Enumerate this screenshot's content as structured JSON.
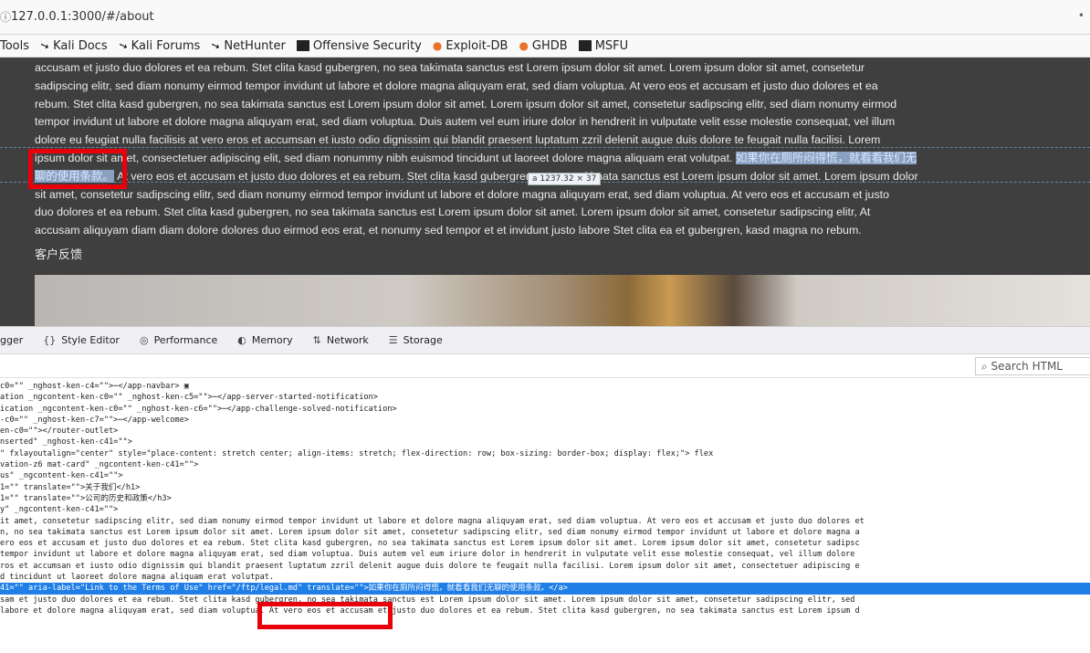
{
  "browser": {
    "url": "127.0.0.1:3000/#/about",
    "bookmarks": [
      "Tools",
      "Kali Docs",
      "Kali Forums",
      "NetHunter",
      "Offensive Security",
      "Exploit-DB",
      "GHDB",
      "MSFU"
    ]
  },
  "page": {
    "paragraph_lines": [
      "accusam et justo duo dolores et ea rebum. Stet clita kasd gubergren, no sea takimata sanctus est Lorem ipsum dolor sit amet. Lorem ipsum dolor sit amet, consetetur",
      "sadipscing elitr, sed diam nonumy eirmod tempor invidunt ut labore et dolore magna aliquyam erat, sed diam voluptua. At vero eos et accusam et justo duo dolores et ea",
      "rebum. Stet clita kasd gubergren, no sea takimata sanctus est Lorem ipsum dolor sit amet. Lorem ipsum dolor sit amet, consetetur sadipscing elitr, sed diam nonumy eirmod",
      "tempor invidunt ut labore et dolore magna aliquyam erat, sed diam voluptua. Duis autem vel eum iriure dolor in hendrerit in vulputate velit esse molestie consequat, vel illum",
      "dolore eu feugiat nulla facilisis at vero eros et accumsan et iusto odio dignissim qui blandit praesent luptatum zzril delenit augue duis dolore te feugait nulla facilisi. Lorem",
      "ipsum dolor sit amet, consectetuer adipiscing elit, sed diam nonummy nibh euismod tincidunt ut laoreet dolore magna aliquam erat volutpat.",
      " At vero eos et accusam et justo duo dolores et ea rebum. Stet clita kasd gubergren, no sea takimata sanctus est Lorem ipsum dolor sit amet. Lorem ipsum dolor",
      "sit amet, consetetur sadipscing elitr, sed diam nonumy eirmod tempor invidunt ut labore et dolore magna aliquyam erat, sed diam voluptua. At vero eos et accusam et justo",
      "duo dolores et ea rebum. Stet clita kasd gubergren, no sea takimata sanctus est Lorem ipsum dolor sit amet. Lorem ipsum dolor sit amet, consetetur sadipscing elitr, At",
      "accusam aliquyam diam diam dolore dolores duo eirmod eos erat, et nonumy sed tempor et et invidunt justo labore Stet clita ea et gubergren, kasd magna no rebum."
    ],
    "link_text_part1": "如果你在厕所闷得慌，就看看我们无",
    "link_text_part2": "聊的使用条款。",
    "subtitle": "客户反馈",
    "tooltip": "a  1237.32 × 37"
  },
  "devtools": {
    "tabs": [
      {
        "icon": "",
        "label": "gger"
      },
      {
        "icon": "{}",
        "label": "Style Editor"
      },
      {
        "icon": "◎",
        "label": "Performance"
      },
      {
        "icon": "◐",
        "label": "Memory"
      },
      {
        "icon": "⇅",
        "label": "Network"
      },
      {
        "icon": "☰",
        "label": "Storage"
      }
    ],
    "search_placeholder": "Search HTML",
    "code_lines": [
      "c0=\"\" _nghost-ken-c4=\"\">⋯</app-navbar> ▣",
      "ation _ngcontent-ken-c0=\"\" _nghost-ken-c5=\"\">⋯</app-server-started-notification>",
      "ication _ngcontent-ken-c0=\"\" _nghost-ken-c6=\"\">⋯</app-challenge-solved-notification>",
      "-c0=\"\" _nghost-ken-c7=\"\">⋯</app-welcome>",
      "en-c0=\"\"></router-outlet>",
      "nserted\" _nghost-ken-c41=\"\">",
      "\" fxlayoutalign=\"center\" style=\"place-content: stretch center; align-items: stretch; flex-direction: row; box-sizing: border-box; display: flex;\"> flex",
      "vation-z6 mat-card\" _ngcontent-ken-c41=\"\">",
      "us\" _ngcontent-ken-c41=\"\">",
      "1=\"\" translate=\"\">关于我们</h1>",
      "1=\"\" translate=\"\">公司的历史和政策</h3>",
      "y\" _ngcontent-ken-c41=\"\">",
      "it amet, consetetur sadipscing elitr, sed diam nonumy eirmod tempor invidunt ut labore et dolore magna aliquyam erat, sed diam voluptua. At vero eos et accusam et justo duo dolores et",
      "n, no sea takimata sanctus est Lorem ipsum dolor sit amet. Lorem ipsum dolor sit amet, consetetur sadipscing elitr, sed diam nonumy eirmod tempor invidunt ut labore et dolore magna a",
      "ero eos et accusam et justo duo dolores et ea rebum. Stet clita kasd gubergren, no sea takimata sanctus est Lorem ipsum dolor sit amet. Lorem ipsum dolor sit amet, consetetur sadipsc",
      "tempor invidunt ut labore et dolore magna aliquyam erat, sed diam voluptua. Duis autem vel eum iriure dolor in hendrerit in vulputate velit esse molestie consequat, vel illum dolore",
      "ros et accumsan et iusto odio dignissim qui blandit praesent luptatum zzril delenit augue duis dolore te feugait nulla facilisi. Lorem ipsum dolor sit amet, consectetuer adipiscing e",
      "d tincidunt ut laoreet dolore magna aliquam erat volutpat.",
      "41=\"\" aria-label=\"Link to the Terms of Use\" href=\"/ftp/legal.md\" translate=\"\">如果你在厕所闷得慌，就看看我们无聊的使用条款。</a>",
      "sam et justo duo dolores et ea rebum. Stet clita kasd gubergren, no sea takimata sanctus est Lorem ipsum dolor sit amet. Lorem ipsum dolor sit amet, consetetur sadipscing elitr, sed",
      "labore et dolore magna aliquyam erat, sed diam voluptua. At vero eos et accusam et justo duo dolores et ea rebum. Stet clita kasd gubergren, no sea takimata sanctus est Lorem ipsum d"
    ],
    "selected_line_index": 18
  },
  "colors": {
    "page_bg": "#3f3f3f",
    "highlight": "#8aa0c0",
    "selection": "#1f7fe7",
    "annotation_red": "#e8000b"
  }
}
